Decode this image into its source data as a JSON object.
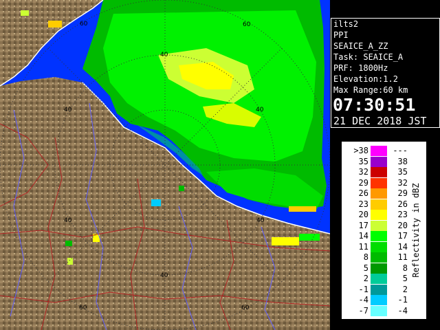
{
  "map": {
    "ring_labels": [
      "60",
      "40",
      "40",
      "40",
      "40",
      "60",
      "60"
    ],
    "colors": {
      "land": "#8a7250",
      "sea": "#0033ff",
      "coast": "#ffffff",
      "border_red": "#b22222",
      "river_blue": "#6060ff"
    }
  },
  "info": {
    "station": "ilts2",
    "mode": "PPI",
    "product": "SEAICE_A_ZZ",
    "task": "Task: SEAICE_A",
    "prf": "PRF: 1800Hz",
    "elevation": "Elevation:1.2",
    "max_range": "Max Range:60 km",
    "time": "07:30:51",
    "date": "21 DEC 2018 JST"
  },
  "legend": {
    "unit_label": "Reflectivity in dBZ",
    "rows": [
      {
        "lo": ">38",
        "hi": "---",
        "color": "#ff00ff"
      },
      {
        "lo": "35",
        "hi": "38",
        "color": "#9900cc"
      },
      {
        "lo": "32",
        "hi": "35",
        "color": "#cc0000"
      },
      {
        "lo": "29",
        "hi": "32",
        "color": "#ff3300"
      },
      {
        "lo": "26",
        "hi": "29",
        "color": "#ff9900"
      },
      {
        "lo": "23",
        "hi": "26",
        "color": "#ffcc00"
      },
      {
        "lo": "20",
        "hi": "23",
        "color": "#ffff00"
      },
      {
        "lo": "17",
        "hi": "20",
        "color": "#ccff33"
      },
      {
        "lo": "14",
        "hi": "17",
        "color": "#00ff00"
      },
      {
        "lo": "11",
        "hi": "14",
        "color": "#00dd00"
      },
      {
        "lo": "8",
        "hi": "11",
        "color": "#00bb00"
      },
      {
        "lo": "5",
        "hi": "8",
        "color": "#009900"
      },
      {
        "lo": "2",
        "hi": "5",
        "color": "#00cc99"
      },
      {
        "lo": "-1",
        "hi": "2",
        "color": "#009999"
      },
      {
        "lo": "-4",
        "hi": "-1",
        "color": "#00ccff"
      },
      {
        "lo": "-7",
        "hi": "-4",
        "color": "#66ffff"
      }
    ]
  }
}
